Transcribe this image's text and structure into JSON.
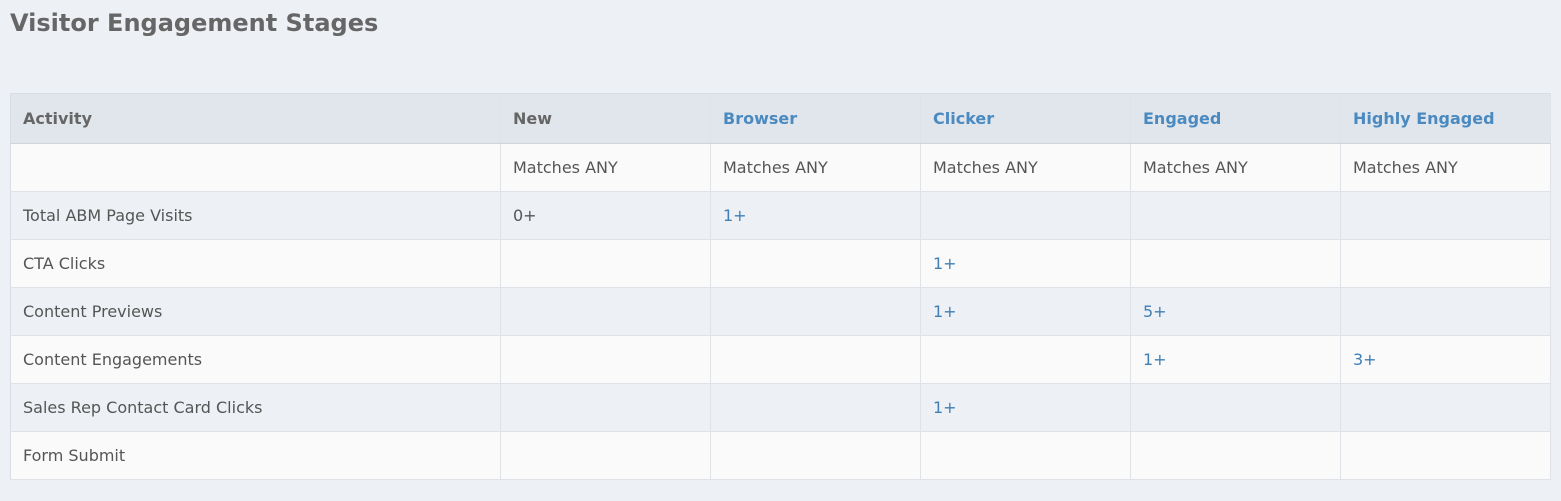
{
  "page": {
    "title": "Visitor Engagement Stages"
  },
  "colors": {
    "background": "#edf0f4",
    "header_bg": "#e1e6ec",
    "link": "#4a8ac0",
    "text": "#555555"
  },
  "table": {
    "headers": [
      "Activity",
      "New",
      "Browser",
      "Clicker",
      "Engaged",
      "Highly Engaged"
    ],
    "rows": [
      [
        "",
        "Matches ANY",
        "Matches ANY",
        "Matches ANY",
        "Matches ANY",
        "Matches ANY"
      ],
      [
        "Total ABM Page Visits",
        "0+",
        "1+",
        "",
        "",
        ""
      ],
      [
        "CTA Clicks",
        "",
        "",
        "1+",
        "",
        ""
      ],
      [
        "Content Previews",
        "",
        "",
        "1+",
        "5+",
        ""
      ],
      [
        "Content Engagements",
        "",
        "",
        "",
        "1+",
        "3+"
      ],
      [
        "Sales Rep Contact Card Clicks",
        "",
        "",
        "1+",
        "",
        ""
      ],
      [
        "Form Submit",
        "",
        "",
        "",
        "",
        ""
      ]
    ]
  }
}
